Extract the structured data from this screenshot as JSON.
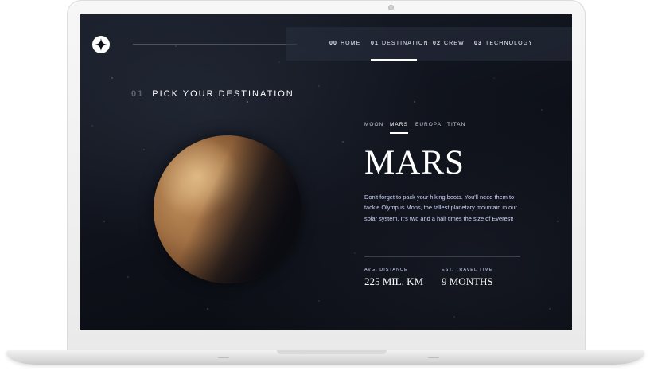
{
  "brand": {
    "logo_icon": "star-logo-icon"
  },
  "nav": {
    "items": [
      {
        "num": "00",
        "label": "HOME",
        "active": false
      },
      {
        "num": "01",
        "label": "DESTINATION",
        "active": true
      },
      {
        "num": "02",
        "label": "CREW",
        "active": false
      },
      {
        "num": "03",
        "label": "TECHNOLOGY",
        "active": false
      }
    ]
  },
  "page": {
    "heading_num": "01",
    "heading": "PICK YOUR DESTINATION"
  },
  "destination": {
    "tabs": [
      {
        "label": "MOON",
        "active": false
      },
      {
        "label": "MARS",
        "active": true
      },
      {
        "label": "EUROPA",
        "active": false
      },
      {
        "label": "TITAN",
        "active": false
      }
    ],
    "name": "MARS",
    "description": "Don't forget to pack your hiking boots. You'll need them to tackle Olympus Mons, the tallest planetary mountain in our solar system. It's two and a half times the size of Everest!",
    "stats": [
      {
        "label": "AVG. DISTANCE",
        "value": "225 MIL. KM"
      },
      {
        "label": "EST. TRAVEL TIME",
        "value": "9 MONTHS"
      }
    ]
  },
  "colors": {
    "background": "#0b0d17",
    "text_light": "#d0d6f9",
    "white": "#ffffff"
  }
}
